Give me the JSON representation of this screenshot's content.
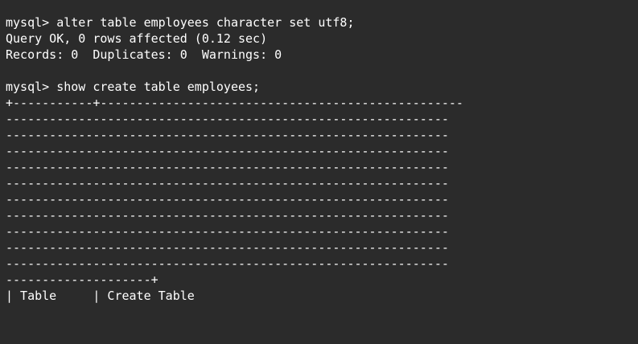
{
  "terminal": {
    "lines": [
      "mysql> alter table employees character set utf8;",
      "Query OK, 0 rows affected (0.12 sec)",
      "Records: 0  Duplicates: 0  Warnings: 0",
      "",
      "mysql> show create table employees;",
      "+-----------+--------------------------------------------------",
      "-------------------------------------------------------------",
      "-------------------------------------------------------------",
      "-------------------------------------------------------------",
      "-------------------------------------------------------------",
      "-------------------------------------------------------------",
      "-------------------------------------------------------------",
      "-------------------------------------------------------------",
      "-------------------------------------------------------------",
      "-------------------------------------------------------------",
      "-------------------------------------------------------------",
      "--------------------+",
      "| Table     | Create Table"
    ]
  }
}
